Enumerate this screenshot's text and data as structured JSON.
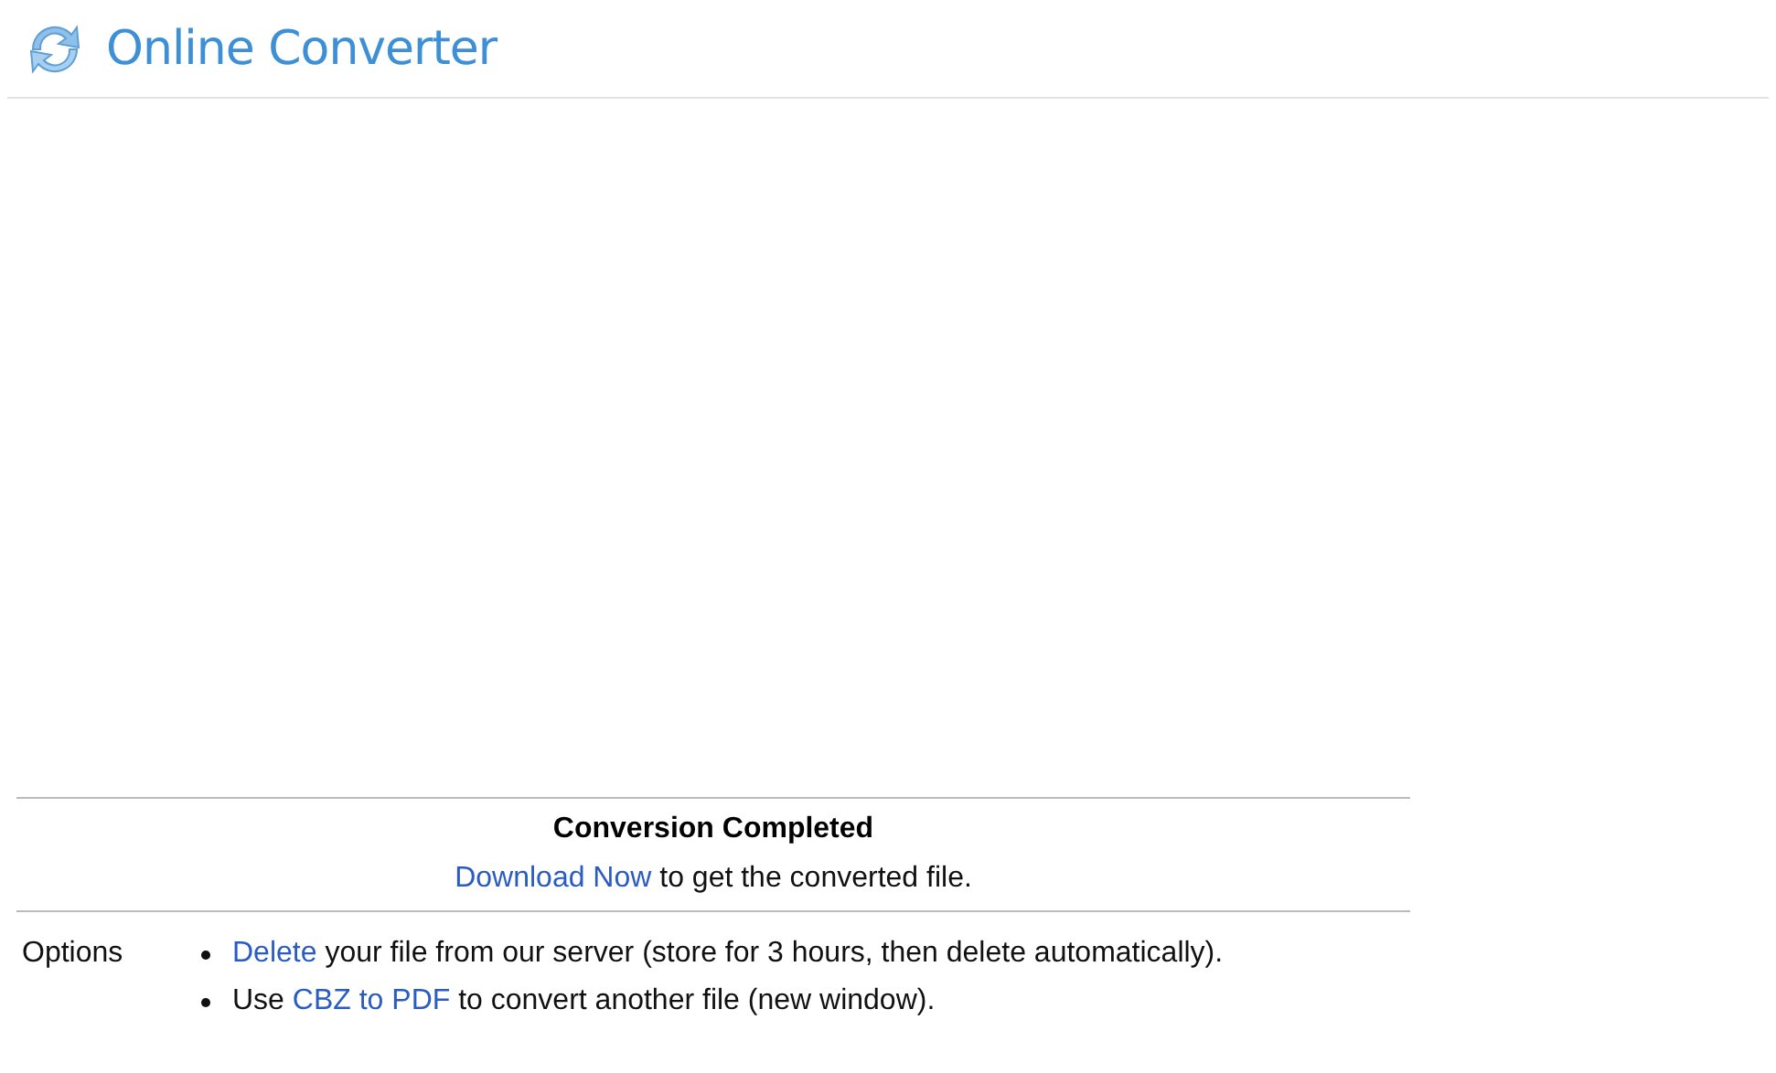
{
  "header": {
    "title": "Online Converter"
  },
  "result": {
    "heading": "Conversion Completed",
    "message": {
      "link": "Download Now",
      "after": " to get the converted file."
    }
  },
  "options": {
    "label": "Options",
    "items": [
      {
        "link": "Delete",
        "after": " your file from our server (store for 3 hours, then delete automatically)."
      },
      {
        "before": "Use ",
        "link": "CBZ to PDF",
        "after": " to convert another file (new window)."
      }
    ]
  }
}
